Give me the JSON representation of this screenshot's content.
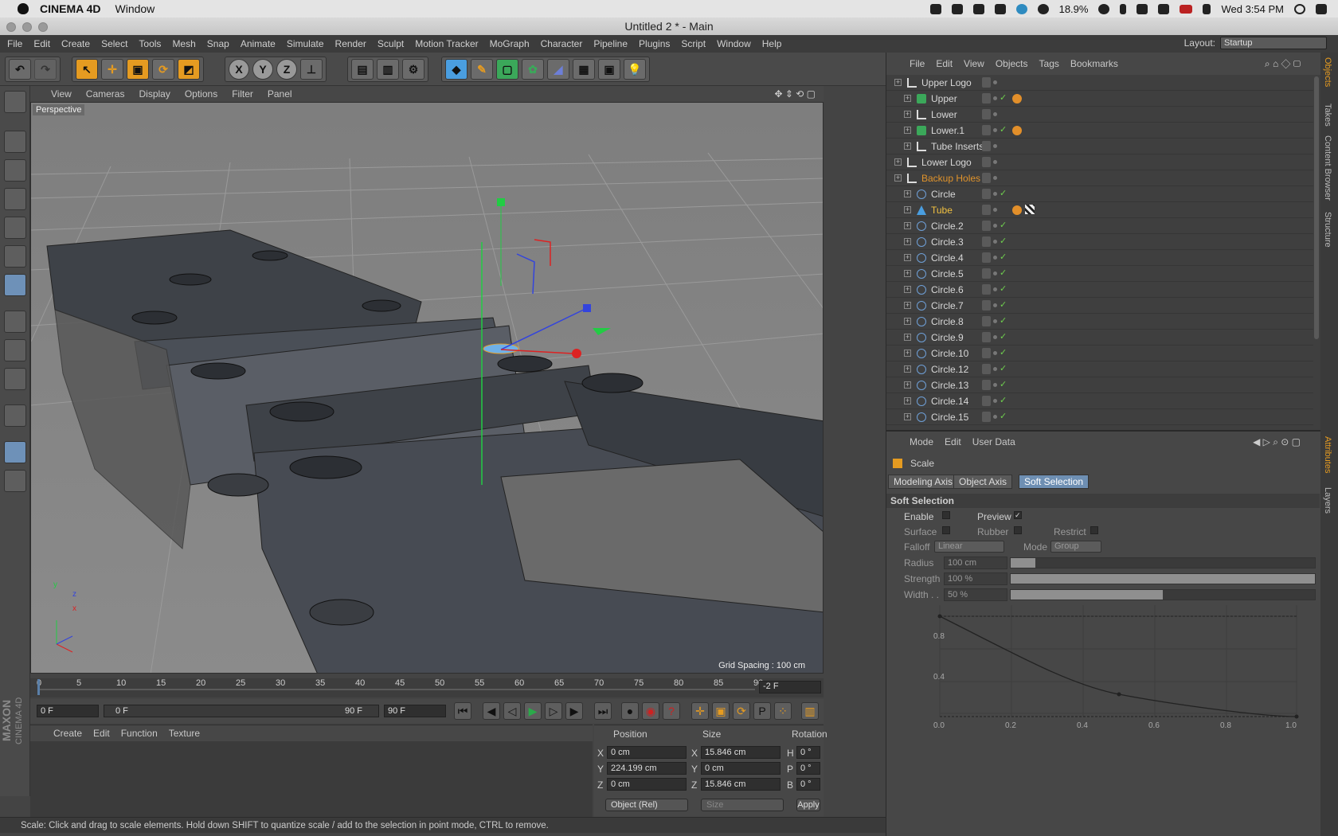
{
  "macbar": {
    "app_name": "CINEMA 4D",
    "menu_window": "Window",
    "battery": "18.9%",
    "clock": "Wed 3:54 PM"
  },
  "window": {
    "title": "Untitled 2 * - Main"
  },
  "menubar": {
    "items": [
      "File",
      "Edit",
      "Create",
      "Select",
      "Tools",
      "Mesh",
      "Snap",
      "Animate",
      "Simulate",
      "Render",
      "Sculpt",
      "Motion Tracker",
      "MoGraph",
      "Character",
      "Pipeline",
      "Plugins",
      "Script",
      "Window",
      "Help"
    ],
    "layout_label": "Layout:",
    "layout_value": "Startup"
  },
  "toolbar": {
    "axis_x": "X",
    "axis_y": "Y",
    "axis_z": "Z"
  },
  "viewport": {
    "menu": [
      "View",
      "Cameras",
      "Display",
      "Options",
      "Filter",
      "Panel"
    ],
    "label": "Perspective",
    "grid_spacing": "Grid Spacing : 100 cm",
    "axis_x": "x",
    "axis_y": "y",
    "axis_z": "z"
  },
  "timeline": {
    "ticks": [
      "0",
      "5",
      "10",
      "15",
      "20",
      "25",
      "30",
      "35",
      "40",
      "45",
      "50",
      "55",
      "60",
      "65",
      "70",
      "75",
      "80",
      "85",
      "90"
    ],
    "current_frame": "-2 F"
  },
  "transport": {
    "start": "0 F",
    "range_start": "0 F",
    "range_end": "90 F",
    "end": "90 F"
  },
  "material_panel": {
    "menu": [
      "Create",
      "Edit",
      "Function",
      "Texture"
    ]
  },
  "maxon": {
    "line1": "MAXON",
    "line2": "CINEMA 4D"
  },
  "coordinates": {
    "headers": {
      "position": "Position",
      "size": "Size",
      "rotation": "Rotation"
    },
    "rows": [
      {
        "axis": "X",
        "pos": "0 cm",
        "saxis": "X",
        "size": "15.846 cm",
        "raxis": "H",
        "rot": "0 °"
      },
      {
        "axis": "Y",
        "pos": "224.199 cm",
        "saxis": "Y",
        "size": "0 cm",
        "raxis": "P",
        "rot": "0 °"
      },
      {
        "axis": "Z",
        "pos": "0 cm",
        "saxis": "Z",
        "size": "15.846 cm",
        "raxis": "B",
        "rot": "0 °"
      }
    ],
    "mode": "Object (Rel)",
    "size_mode": "Size",
    "apply": "Apply"
  },
  "status": {
    "text": "Scale: Click and drag to scale elements. Hold down SHIFT to quantize scale / add to the selection in point mode, CTRL to remove."
  },
  "objects": {
    "menu": [
      "File",
      "Edit",
      "View",
      "Objects",
      "Tags",
      "Bookmarks"
    ],
    "items": [
      {
        "name": "Upper Logo",
        "indent": 0,
        "icon": "null",
        "color": "#d8d8d8",
        "check": false,
        "tags": []
      },
      {
        "name": "Upper",
        "indent": 1,
        "icon": "generator",
        "color": "#d8d8d8",
        "check": true,
        "tags": [
          "orange"
        ]
      },
      {
        "name": "Lower",
        "indent": 1,
        "icon": "null",
        "color": "#d8d8d8",
        "check": false,
        "tags": []
      },
      {
        "name": "Lower.1",
        "indent": 1,
        "icon": "generator",
        "color": "#d8d8d8",
        "check": true,
        "tags": [
          "orange"
        ]
      },
      {
        "name": "Tube Inserts",
        "indent": 1,
        "icon": "null",
        "color": "#d8d8d8",
        "check": false,
        "tags": []
      },
      {
        "name": "Lower Logo",
        "indent": 0,
        "icon": "null",
        "color": "#d8d8d8",
        "check": false,
        "tags": []
      },
      {
        "name": "Backup Holes",
        "indent": 0,
        "icon": "null",
        "color": "#e0932b",
        "check": false,
        "tags": []
      },
      {
        "name": "Circle",
        "indent": 1,
        "icon": "circle",
        "color": "#d8d8d8",
        "check": true,
        "tags": []
      },
      {
        "name": "Tube",
        "indent": 1,
        "icon": "tube",
        "color": "#f0c040",
        "check": false,
        "tags": [
          "orange",
          "checker"
        ]
      },
      {
        "name": "Circle.2",
        "indent": 1,
        "icon": "circle",
        "color": "#d8d8d8",
        "check": true,
        "tags": []
      },
      {
        "name": "Circle.3",
        "indent": 1,
        "icon": "circle",
        "color": "#d8d8d8",
        "check": true,
        "tags": []
      },
      {
        "name": "Circle.4",
        "indent": 1,
        "icon": "circle",
        "color": "#d8d8d8",
        "check": true,
        "tags": []
      },
      {
        "name": "Circle.5",
        "indent": 1,
        "icon": "circle",
        "color": "#d8d8d8",
        "check": true,
        "tags": []
      },
      {
        "name": "Circle.6",
        "indent": 1,
        "icon": "circle",
        "color": "#d8d8d8",
        "check": true,
        "tags": []
      },
      {
        "name": "Circle.7",
        "indent": 1,
        "icon": "circle",
        "color": "#d8d8d8",
        "check": true,
        "tags": []
      },
      {
        "name": "Circle.8",
        "indent": 1,
        "icon": "circle",
        "color": "#d8d8d8",
        "check": true,
        "tags": []
      },
      {
        "name": "Circle.9",
        "indent": 1,
        "icon": "circle",
        "color": "#d8d8d8",
        "check": true,
        "tags": []
      },
      {
        "name": "Circle.10",
        "indent": 1,
        "icon": "circle",
        "color": "#d8d8d8",
        "check": true,
        "tags": []
      },
      {
        "name": "Circle.12",
        "indent": 1,
        "icon": "circle",
        "color": "#d8d8d8",
        "check": true,
        "tags": []
      },
      {
        "name": "Circle.13",
        "indent": 1,
        "icon": "circle",
        "color": "#d8d8d8",
        "check": true,
        "tags": []
      },
      {
        "name": "Circle.14",
        "indent": 1,
        "icon": "circle",
        "color": "#d8d8d8",
        "check": true,
        "tags": []
      },
      {
        "name": "Circle.15",
        "indent": 1,
        "icon": "circle",
        "color": "#d8d8d8",
        "check": true,
        "tags": []
      }
    ]
  },
  "side_tabs_top": [
    "Objects",
    "Takes",
    "Content Browser",
    "Structure"
  ],
  "side_tabs_bottom": [
    "Attributes",
    "Layers"
  ],
  "attributes": {
    "menu": [
      "Mode",
      "Edit",
      "User Data"
    ],
    "tool_name": "Scale",
    "tabs": [
      "Modeling Axis",
      "Object Axis",
      "Soft Selection"
    ],
    "section": "Soft Selection",
    "enable": "Enable",
    "preview": "Preview",
    "preview_check": "✓",
    "surface": "Surface",
    "rubber": "Rubber",
    "restrict": "Restrict",
    "falloff": "Falloff",
    "falloff_value": "Linear",
    "mode": "Mode",
    "mode_value": "Group",
    "radius": "Radius",
    "radius_value": "100 cm",
    "radius_level": 0.08,
    "strength": "Strength",
    "strength_value": "100 %",
    "strength_level": 1.0,
    "width": "Width . .",
    "width_value": "50 %",
    "width_level": 0.5,
    "curve_y_labels": [
      "0.8",
      "0.4"
    ],
    "curve_x_labels": [
      "0.0",
      "0.2",
      "0.4",
      "0.6",
      "0.8",
      "1.0"
    ]
  }
}
